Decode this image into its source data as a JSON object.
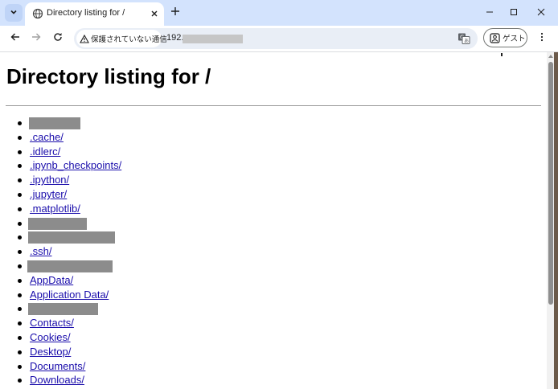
{
  "browser": {
    "tab": {
      "title": "Directory listing for /"
    },
    "toolbar": {
      "security_chip": "保護されていない通信",
      "url_prefix": "192.",
      "profile_label": "ゲスト"
    },
    "icons": {
      "tab_search": "chevron-down-icon",
      "favicon": "globe-icon",
      "close": "close-icon",
      "new_tab": "plus-icon",
      "back": "arrow-left-icon",
      "forward": "arrow-right-icon",
      "reload": "reload-icon",
      "warning": "warning-triangle-icon",
      "translate": "translate-icon",
      "profile": "person-icon",
      "menu": "kebab-menu-icon"
    }
  },
  "page": {
    "heading": "Directory listing for /",
    "entries": [
      {
        "label": "",
        "redacted": true
      },
      {
        "label": ".cache/"
      },
      {
        "label": ".idlerc/"
      },
      {
        "label": ".ipynb_checkpoints/"
      },
      {
        "label": ".ipython/"
      },
      {
        "label": ".jupyter/"
      },
      {
        "label": ".matplotlib/"
      },
      {
        "label": "",
        "redacted": true
      },
      {
        "label": "",
        "redacted": true
      },
      {
        "label": ".ssh/"
      },
      {
        "label": "",
        "redacted": true
      },
      {
        "label": "AppData/"
      },
      {
        "label": "Application Data/"
      },
      {
        "label": "",
        "redacted": true
      },
      {
        "label": "Contacts/"
      },
      {
        "label": "Cookies/"
      },
      {
        "label": "Desktop/"
      },
      {
        "label": "Documents/"
      },
      {
        "label": "Downloads/"
      }
    ]
  },
  "colors": {
    "tabstrip": "#d3e3fd",
    "link": "#1a0dab",
    "redaction": "#8c8c8c"
  }
}
